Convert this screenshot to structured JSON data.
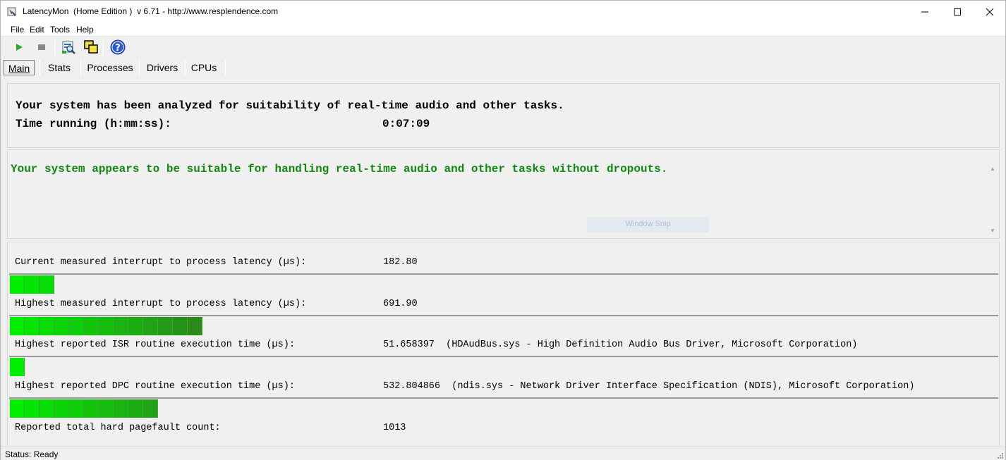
{
  "window": {
    "title": "LatencyMon  (Home Edition )  v 6.71 - http://www.resplendence.com"
  },
  "menu": [
    "File",
    "Edit",
    "Tools",
    "Help"
  ],
  "toolbar": {
    "icons": [
      "start-icon",
      "stop-icon",
      "report-icon",
      "windows-icon",
      "help-icon"
    ]
  },
  "tabs": [
    "Main",
    "Stats",
    "Processes",
    "Drivers",
    "CPUs"
  ],
  "summary": {
    "analyzed_text": "Your system has been analyzed for suitability of real-time audio and other tasks.",
    "time_label": "Time running (h:mm:ss):",
    "time_value": "0:07:09"
  },
  "verdict": {
    "text": "Your system appears to be suitable for handling real-time audio and other tasks without dropouts.",
    "color": "#108a10",
    "snip_label": "Window Snip"
  },
  "metrics": [
    {
      "label": "Current measured interrupt to process latency (µs):",
      "value": "182.80",
      "bar_segments": 3
    },
    {
      "label": "Highest measured interrupt to process latency (µs):",
      "value": "691.90",
      "bar_segments": 13
    },
    {
      "label": "Highest reported ISR routine execution time (µs):",
      "value": "51.658397  (HDAudBus.sys - High Definition Audio Bus Driver, Microsoft Corporation)",
      "bar_segments": 1
    },
    {
      "label": "Highest reported DPC routine execution time (µs):",
      "value": "532.804866  (ndis.sys - Network Driver Interface Specification (NDIS), Microsoft Corporation)",
      "bar_segments": 10
    },
    {
      "label": "Reported total hard pagefault count:",
      "value": "1013"
    }
  ],
  "colors": {
    "bar_light": "#00ee00",
    "bar_dark": "#2a8a1a"
  },
  "status": {
    "text": "Status: Ready"
  }
}
